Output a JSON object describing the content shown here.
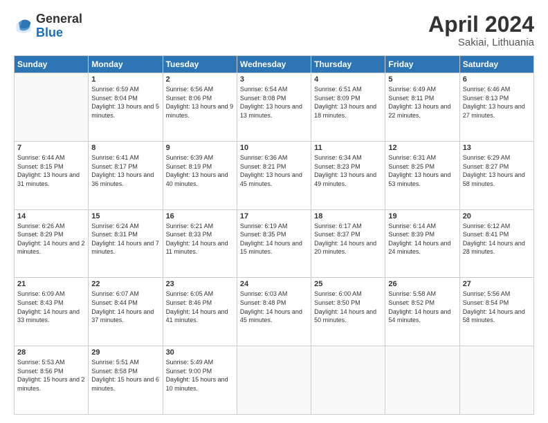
{
  "header": {
    "logo_general": "General",
    "logo_blue": "Blue",
    "month_year": "April 2024",
    "location": "Sakiai, Lithuania"
  },
  "weekdays": [
    "Sunday",
    "Monday",
    "Tuesday",
    "Wednesday",
    "Thursday",
    "Friday",
    "Saturday"
  ],
  "weeks": [
    [
      {
        "day": "",
        "sunrise": "",
        "sunset": "",
        "daylight": ""
      },
      {
        "day": "1",
        "sunrise": "Sunrise: 6:59 AM",
        "sunset": "Sunset: 8:04 PM",
        "daylight": "Daylight: 13 hours and 5 minutes."
      },
      {
        "day": "2",
        "sunrise": "Sunrise: 6:56 AM",
        "sunset": "Sunset: 8:06 PM",
        "daylight": "Daylight: 13 hours and 9 minutes."
      },
      {
        "day": "3",
        "sunrise": "Sunrise: 6:54 AM",
        "sunset": "Sunset: 8:08 PM",
        "daylight": "Daylight: 13 hours and 13 minutes."
      },
      {
        "day": "4",
        "sunrise": "Sunrise: 6:51 AM",
        "sunset": "Sunset: 8:09 PM",
        "daylight": "Daylight: 13 hours and 18 minutes."
      },
      {
        "day": "5",
        "sunrise": "Sunrise: 6:49 AM",
        "sunset": "Sunset: 8:11 PM",
        "daylight": "Daylight: 13 hours and 22 minutes."
      },
      {
        "day": "6",
        "sunrise": "Sunrise: 6:46 AM",
        "sunset": "Sunset: 8:13 PM",
        "daylight": "Daylight: 13 hours and 27 minutes."
      }
    ],
    [
      {
        "day": "7",
        "sunrise": "Sunrise: 6:44 AM",
        "sunset": "Sunset: 8:15 PM",
        "daylight": "Daylight: 13 hours and 31 minutes."
      },
      {
        "day": "8",
        "sunrise": "Sunrise: 6:41 AM",
        "sunset": "Sunset: 8:17 PM",
        "daylight": "Daylight: 13 hours and 36 minutes."
      },
      {
        "day": "9",
        "sunrise": "Sunrise: 6:39 AM",
        "sunset": "Sunset: 8:19 PM",
        "daylight": "Daylight: 13 hours and 40 minutes."
      },
      {
        "day": "10",
        "sunrise": "Sunrise: 6:36 AM",
        "sunset": "Sunset: 8:21 PM",
        "daylight": "Daylight: 13 hours and 45 minutes."
      },
      {
        "day": "11",
        "sunrise": "Sunrise: 6:34 AM",
        "sunset": "Sunset: 8:23 PM",
        "daylight": "Daylight: 13 hours and 49 minutes."
      },
      {
        "day": "12",
        "sunrise": "Sunrise: 6:31 AM",
        "sunset": "Sunset: 8:25 PM",
        "daylight": "Daylight: 13 hours and 53 minutes."
      },
      {
        "day": "13",
        "sunrise": "Sunrise: 6:29 AM",
        "sunset": "Sunset: 8:27 PM",
        "daylight": "Daylight: 13 hours and 58 minutes."
      }
    ],
    [
      {
        "day": "14",
        "sunrise": "Sunrise: 6:26 AM",
        "sunset": "Sunset: 8:29 PM",
        "daylight": "Daylight: 14 hours and 2 minutes."
      },
      {
        "day": "15",
        "sunrise": "Sunrise: 6:24 AM",
        "sunset": "Sunset: 8:31 PM",
        "daylight": "Daylight: 14 hours and 7 minutes."
      },
      {
        "day": "16",
        "sunrise": "Sunrise: 6:21 AM",
        "sunset": "Sunset: 8:33 PM",
        "daylight": "Daylight: 14 hours and 11 minutes."
      },
      {
        "day": "17",
        "sunrise": "Sunrise: 6:19 AM",
        "sunset": "Sunset: 8:35 PM",
        "daylight": "Daylight: 14 hours and 15 minutes."
      },
      {
        "day": "18",
        "sunrise": "Sunrise: 6:17 AM",
        "sunset": "Sunset: 8:37 PM",
        "daylight": "Daylight: 14 hours and 20 minutes."
      },
      {
        "day": "19",
        "sunrise": "Sunrise: 6:14 AM",
        "sunset": "Sunset: 8:39 PM",
        "daylight": "Daylight: 14 hours and 24 minutes."
      },
      {
        "day": "20",
        "sunrise": "Sunrise: 6:12 AM",
        "sunset": "Sunset: 8:41 PM",
        "daylight": "Daylight: 14 hours and 28 minutes."
      }
    ],
    [
      {
        "day": "21",
        "sunrise": "Sunrise: 6:09 AM",
        "sunset": "Sunset: 8:43 PM",
        "daylight": "Daylight: 14 hours and 33 minutes."
      },
      {
        "day": "22",
        "sunrise": "Sunrise: 6:07 AM",
        "sunset": "Sunset: 8:44 PM",
        "daylight": "Daylight: 14 hours and 37 minutes."
      },
      {
        "day": "23",
        "sunrise": "Sunrise: 6:05 AM",
        "sunset": "Sunset: 8:46 PM",
        "daylight": "Daylight: 14 hours and 41 minutes."
      },
      {
        "day": "24",
        "sunrise": "Sunrise: 6:03 AM",
        "sunset": "Sunset: 8:48 PM",
        "daylight": "Daylight: 14 hours and 45 minutes."
      },
      {
        "day": "25",
        "sunrise": "Sunrise: 6:00 AM",
        "sunset": "Sunset: 8:50 PM",
        "daylight": "Daylight: 14 hours and 50 minutes."
      },
      {
        "day": "26",
        "sunrise": "Sunrise: 5:58 AM",
        "sunset": "Sunset: 8:52 PM",
        "daylight": "Daylight: 14 hours and 54 minutes."
      },
      {
        "day": "27",
        "sunrise": "Sunrise: 5:56 AM",
        "sunset": "Sunset: 8:54 PM",
        "daylight": "Daylight: 14 hours and 58 minutes."
      }
    ],
    [
      {
        "day": "28",
        "sunrise": "Sunrise: 5:53 AM",
        "sunset": "Sunset: 8:56 PM",
        "daylight": "Daylight: 15 hours and 2 minutes."
      },
      {
        "day": "29",
        "sunrise": "Sunrise: 5:51 AM",
        "sunset": "Sunset: 8:58 PM",
        "daylight": "Daylight: 15 hours and 6 minutes."
      },
      {
        "day": "30",
        "sunrise": "Sunrise: 5:49 AM",
        "sunset": "Sunset: 9:00 PM",
        "daylight": "Daylight: 15 hours and 10 minutes."
      },
      {
        "day": "",
        "sunrise": "",
        "sunset": "",
        "daylight": ""
      },
      {
        "day": "",
        "sunrise": "",
        "sunset": "",
        "daylight": ""
      },
      {
        "day": "",
        "sunrise": "",
        "sunset": "",
        "daylight": ""
      },
      {
        "day": "",
        "sunrise": "",
        "sunset": "",
        "daylight": ""
      }
    ]
  ]
}
